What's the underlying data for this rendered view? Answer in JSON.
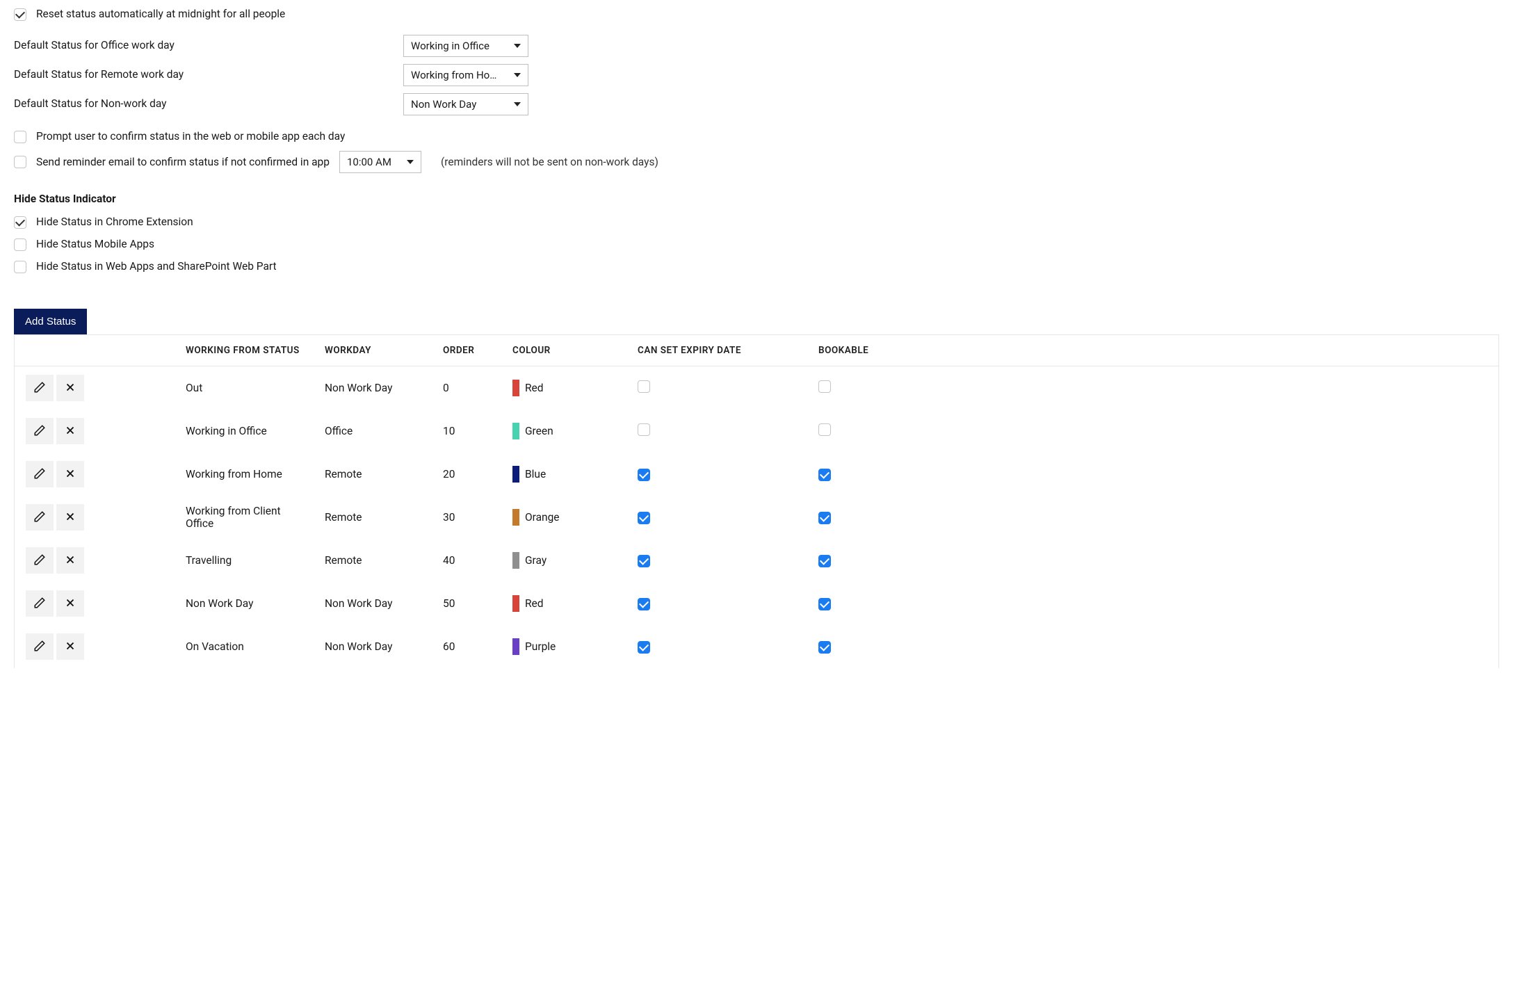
{
  "settings": {
    "reset_midnight": {
      "label": "Reset status automatically at midnight for all people",
      "checked": true
    },
    "default_office": {
      "label": "Default Status for Office work day",
      "value": "Working in Office"
    },
    "default_remote": {
      "label": "Default Status for Remote work day",
      "value": "Working from Ho…"
    },
    "default_nonwork": {
      "label": "Default Status for Non-work day",
      "value": "Non Work Day"
    },
    "prompt_confirm": {
      "label": "Prompt user to confirm status in the web or mobile app each day",
      "checked": false
    },
    "reminder_email": {
      "label": "Send reminder email to confirm status if not confirmed in app",
      "checked": false,
      "time": "10:00 AM",
      "note": "(reminders will not be sent on non-work days)"
    }
  },
  "hide_indicator": {
    "heading": "Hide Status Indicator",
    "chrome": {
      "label": "Hide Status in Chrome Extension",
      "checked": true
    },
    "mobile": {
      "label": "Hide Status Mobile Apps",
      "checked": false
    },
    "web": {
      "label": "Hide Status in Web Apps and SharePoint Web Part",
      "checked": false
    }
  },
  "add_status_label": "Add Status",
  "table": {
    "headers": {
      "status": "WORKING FROM STATUS",
      "workday": "WORKDAY",
      "order": "ORDER",
      "colour": "COLOUR",
      "expiry": "CAN SET EXPIRY DATE",
      "bookable": "BOOKABLE"
    },
    "rows": [
      {
        "status": "Out",
        "workday": "Non Work Day",
        "order": "0",
        "colour_name": "Red",
        "colour_hex": "#d8443a",
        "expiry": false,
        "bookable": false
      },
      {
        "status": "Working in Office",
        "workday": "Office",
        "order": "10",
        "colour_name": "Green",
        "colour_hex": "#47d2b0",
        "expiry": false,
        "bookable": false
      },
      {
        "status": "Working from Home",
        "workday": "Remote",
        "order": "20",
        "colour_name": "Blue",
        "colour_hex": "#0b1c7a",
        "expiry": true,
        "bookable": true
      },
      {
        "status": "Working from Client Office",
        "workday": "Remote",
        "order": "30",
        "colour_name": "Orange",
        "colour_hex": "#c47a2a",
        "expiry": true,
        "bookable": true
      },
      {
        "status": "Travelling",
        "workday": "Remote",
        "order": "40",
        "colour_name": "Gray",
        "colour_hex": "#8f8f8f",
        "expiry": true,
        "bookable": true
      },
      {
        "status": "Non Work Day",
        "workday": "Non Work Day",
        "order": "50",
        "colour_name": "Red",
        "colour_hex": "#d8443a",
        "expiry": true,
        "bookable": true
      },
      {
        "status": "On Vacation",
        "workday": "Non Work Day",
        "order": "60",
        "colour_name": "Purple",
        "colour_hex": "#6a3fc7",
        "expiry": true,
        "bookable": true
      }
    ]
  }
}
